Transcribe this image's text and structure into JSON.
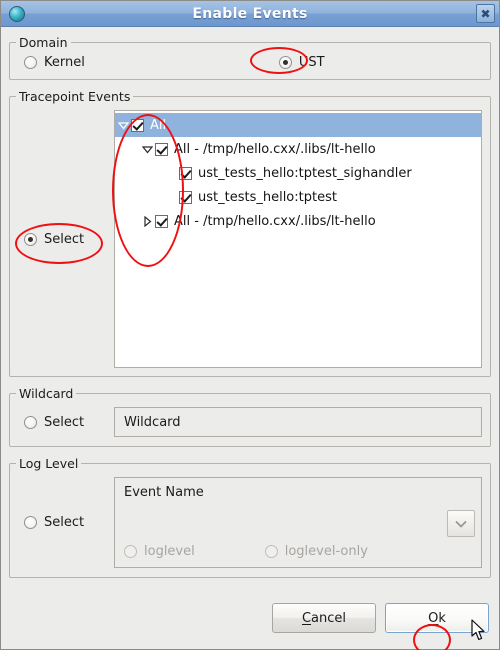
{
  "window": {
    "title": "Enable Events",
    "icon": "globe-icon",
    "close_label": "✖"
  },
  "domain": {
    "legend": "Domain",
    "options": [
      {
        "label": "Kernel",
        "selected": false
      },
      {
        "label": "UST",
        "selected": true
      }
    ]
  },
  "tracepoint": {
    "legend": "Tracepoint Events",
    "select_label": "Select",
    "select_checked": true,
    "rows": [
      {
        "label": "All",
        "indent": 0,
        "twisty": "down",
        "checked": true,
        "selected": true
      },
      {
        "label": "All - /tmp/hello.cxx/.libs/lt-hello",
        "indent": 1,
        "twisty": "down",
        "checked": true,
        "selected": false
      },
      {
        "label": "ust_tests_hello:tptest_sighandler",
        "indent": 2,
        "twisty": "none",
        "checked": true,
        "selected": false
      },
      {
        "label": "ust_tests_hello:tptest",
        "indent": 2,
        "twisty": "none",
        "checked": true,
        "selected": false
      },
      {
        "label": "All - /tmp/hello.cxx/.libs/lt-hello",
        "indent": 1,
        "twisty": "right",
        "checked": true,
        "selected": false
      }
    ]
  },
  "wildcard": {
    "legend": "Wildcard",
    "select_label": "Select",
    "select_checked": false,
    "input_value": "Wildcard"
  },
  "loglevel": {
    "legend": "Log Level",
    "select_label": "Select",
    "select_checked": false,
    "event_name_label": "Event Name",
    "combo_icon": "chevron-down-icon",
    "options": [
      {
        "label": "loglevel",
        "selected": false,
        "disabled": true
      },
      {
        "label": "loglevel-only",
        "selected": false,
        "disabled": true
      }
    ]
  },
  "buttons": {
    "cancel": {
      "prefix": "",
      "accel": "C",
      "rest": "ancel"
    },
    "ok": {
      "prefix": "",
      "accel": "O",
      "rest": "k"
    }
  },
  "colors": {
    "titlebar_top": "#a6c3e4",
    "titlebar_bottom": "#6d97cf",
    "selection": "#8fb3dd",
    "panel": "#ececeb",
    "annotation": "#ee1111"
  }
}
